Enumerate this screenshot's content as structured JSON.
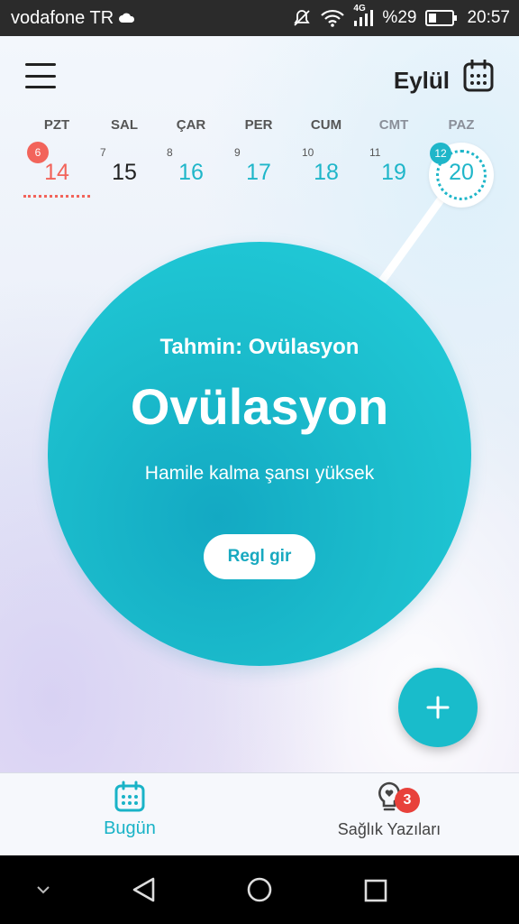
{
  "status_bar": {
    "carrier": "vodafone TR",
    "network": "4G",
    "battery": "%29",
    "time": "20:57"
  },
  "header": {
    "month": "Eylül"
  },
  "week": [
    {
      "day": "PZT",
      "date": "14",
      "badge": "6",
      "style": "red"
    },
    {
      "day": "SAL",
      "date": "15",
      "small": "7",
      "style": "dark"
    },
    {
      "day": "ÇAR",
      "date": "16",
      "small": "8",
      "style": "teal"
    },
    {
      "day": "PER",
      "date": "17",
      "small": "9",
      "style": "teal"
    },
    {
      "day": "CUM",
      "date": "18",
      "small": "10",
      "style": "teal"
    },
    {
      "day": "CMT",
      "date": "19",
      "small": "11",
      "style": "teal"
    },
    {
      "day": "PAZ",
      "date": "20",
      "badge": "12",
      "style": "today"
    }
  ],
  "main": {
    "prediction_label": "Tahmin: Ovülasyon",
    "phase_title": "Ovülasyon",
    "description": "Hamile kalma şansı yüksek",
    "period_button": "Regl gir"
  },
  "bottom_nav": {
    "today_label": "Bugün",
    "articles_label": "Sağlık Yazıları",
    "articles_badge": "3"
  },
  "colors": {
    "accent": "#1fb6c9",
    "period": "#f2645b",
    "badge": "#e8413b"
  }
}
